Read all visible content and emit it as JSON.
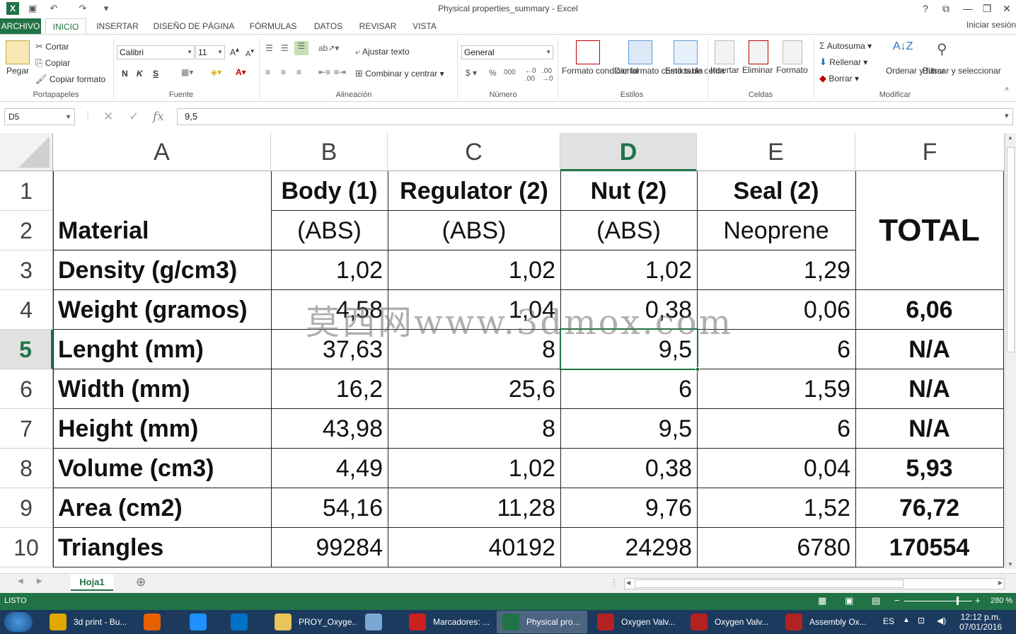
{
  "window": {
    "title": "Physical properties_summary - Excel",
    "help": "?",
    "ribbon_opts": "⧉",
    "minimize": "—",
    "restore": "❐",
    "close": "✕"
  },
  "qat": {
    "save": "💾",
    "undo": "↶",
    "redo": "↷",
    "customize": "▾"
  },
  "tabs": [
    "ARCHIVO",
    "INICIO",
    "INSERTAR",
    "DISEÑO DE PÁGINA",
    "FÓRMULAS",
    "DATOS",
    "REVISAR",
    "VISTA"
  ],
  "signin": "Iniciar sesión",
  "ribbon": {
    "clipboard": {
      "paste": "Pegar",
      "cut": "Cortar",
      "copy": "Copiar",
      "format_painter": "Copiar formato",
      "label": "Portapapeles"
    },
    "font": {
      "name": "Calibri",
      "size": "11",
      "bold": "N",
      "italic": "K",
      "underline": "S",
      "label": "Fuente"
    },
    "alignment": {
      "wrap": "Ajustar texto",
      "merge": "Combinar y centrar",
      "label": "Alineación"
    },
    "number": {
      "format": "General",
      "label": "Número"
    },
    "styles": {
      "cond_format": "Formato condicional",
      "as_table": "Dar formato como tabla",
      "cell_styles": "Estilos de celda",
      "label": "Estilos"
    },
    "cells": {
      "insert": "Insertar",
      "delete": "Eliminar",
      "format": "Formato",
      "label": "Celdas"
    },
    "editing": {
      "autosum": "Autosuma",
      "fill": "Rellenar",
      "clear": "Borrar",
      "sort": "Ordenar y filtrar",
      "find": "Buscar y seleccionar",
      "label": "Modificar"
    }
  },
  "formula_bar": {
    "name_box": "D5",
    "fx": "fx",
    "value": "9,5"
  },
  "columns": [
    "A",
    "B",
    "C",
    "D",
    "E",
    "F"
  ],
  "rows": [
    "1",
    "2",
    "3",
    "4",
    "5",
    "6",
    "7",
    "8",
    "9",
    "10"
  ],
  "cells": {
    "r1": {
      "b": "Body (1)",
      "c": "Regulator (2)",
      "d": "Nut (2)",
      "e": "Seal (2)"
    },
    "r2": {
      "a": "Material",
      "b": "(ABS)",
      "c": "(ABS)",
      "d": "(ABS)",
      "e": "Neoprene",
      "f": "TOTAL"
    },
    "r3": {
      "a": "Density (g/cm3)",
      "b": "1,02",
      "c": "1,02",
      "d": "1,02",
      "e": "1,29"
    },
    "r4": {
      "a": "Weight (gramos)",
      "b": "4,58",
      "c": "1,04",
      "d": "0,38",
      "e": "0,06",
      "f": "6,06"
    },
    "r5": {
      "a": "Lenght (mm)",
      "b": "37,63",
      "c": "8",
      "d": "9,5",
      "e": "6",
      "f": "N/A"
    },
    "r6": {
      "a": "Width (mm)",
      "b": "16,2",
      "c": "25,6",
      "d": "6",
      "e": "1,59",
      "f": "N/A"
    },
    "r7": {
      "a": "Height (mm)",
      "b": "43,98",
      "c": "8",
      "d": "9,5",
      "e": "6",
      "f": "N/A"
    },
    "r8": {
      "a": "Volume (cm3)",
      "b": "4,49",
      "c": "1,02",
      "d": "0,38",
      "e": "0,04",
      "f": "5,93"
    },
    "r9": {
      "a": "Area (cm2)",
      "b": "54,16",
      "c": "11,28",
      "d": "9,76",
      "e": "1,52",
      "f": "76,72"
    },
    "r10": {
      "a": "Triangles",
      "b": "99284",
      "c": "40192",
      "d": "24298",
      "e": "6780",
      "f": "170554"
    }
  },
  "watermark": "莫西网www.3dmox.com",
  "sheets": [
    "Hoja1"
  ],
  "add_sheet": "⊕",
  "status": {
    "ready": "LISTO",
    "zoom": "280 %"
  },
  "taskbar": {
    "items": [
      {
        "label": "3d print - Bu...",
        "color": "#e0a800"
      },
      {
        "label": "",
        "color": "#e66000"
      },
      {
        "label": "",
        "color": "#1e90ff"
      },
      {
        "label": "",
        "color": "#0072c6"
      },
      {
        "label": "PROY_Oxyge...",
        "color": "#e8c45a"
      },
      {
        "label": "",
        "color": "#7aa7d6"
      },
      {
        "label": "Marcadores: ...",
        "color": "#cc1f1f"
      },
      {
        "label": "Physical pro...",
        "color": "#217346"
      },
      {
        "label": "Oxygen Valv...",
        "color": "#b22222"
      },
      {
        "label": "Oxygen Valv...",
        "color": "#b22222"
      },
      {
        "label": "Assembly Ox...",
        "color": "#b22222"
      }
    ],
    "lang": "ES",
    "time": "12:12 p.m.",
    "date": "07/01/2016"
  },
  "colors": {
    "excel_green": "#217346",
    "taskbar": "#1c3a5e"
  }
}
